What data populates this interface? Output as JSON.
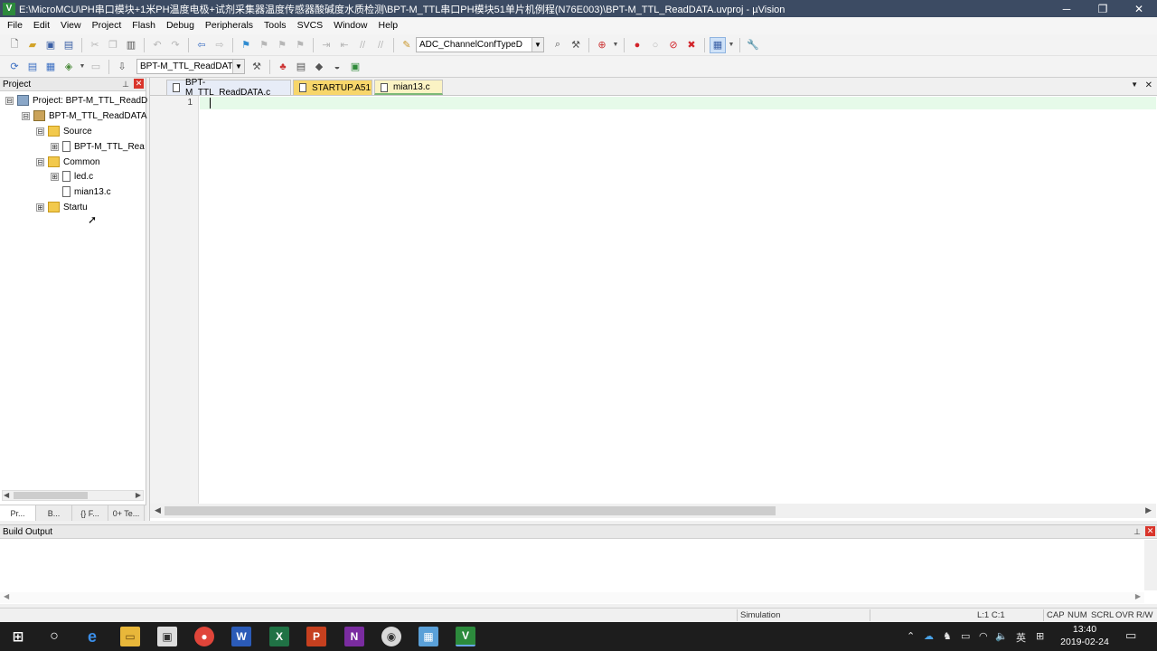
{
  "window": {
    "title": "E:\\MicroMCU\\PH串口模块+1米PH温度电极+试剂采集器温度传感器酸碱度水质检测\\BPT-M_TTL串口PH模块51单片机例程(N76E003)\\BPT-M_TTL_ReadDATA.uvproj - µVision",
    "minimize": "─",
    "maximize": "❐",
    "close": "✕"
  },
  "menu": [
    "File",
    "Edit",
    "View",
    "Project",
    "Flash",
    "Debug",
    "Peripherals",
    "Tools",
    "SVCS",
    "Window",
    "Help"
  ],
  "toolbar": {
    "function_combo": "ADC_ChannelConfTypeD",
    "target_combo": "BPT-M_TTL_ReadDATA"
  },
  "project_panel": {
    "title": "Project",
    "tree": [
      {
        "label": "Project: BPT-M_TTL_ReadD",
        "kind": "project",
        "expander": "⊟"
      },
      {
        "label": "BPT-M_TTL_ReadDATA",
        "kind": "target",
        "expander": "⊟"
      },
      {
        "label": "Source",
        "kind": "folder",
        "expander": "⊟"
      },
      {
        "label": "BPT-M_TTL_Rea",
        "kind": "file",
        "expander": "⊞"
      },
      {
        "label": "Common",
        "kind": "folder",
        "expander": "⊟"
      },
      {
        "label": "led.c",
        "kind": "file",
        "expander": "⊞"
      },
      {
        "label": "mian13.c",
        "kind": "file",
        "expander": ""
      },
      {
        "label": "Startu",
        "kind": "folder",
        "expander": "⊞"
      }
    ],
    "tabs": [
      "Pr...",
      "B...",
      "{} F...",
      "0+ Te..."
    ]
  },
  "editor": {
    "tabs": [
      {
        "label": "BPT-M_TTL_ReadDATA.c"
      },
      {
        "label": "STARTUP.A51"
      },
      {
        "label": "mian13.c"
      }
    ],
    "line_number": "1"
  },
  "build_output": {
    "title": "Build Output"
  },
  "status": {
    "mode": "Simulation",
    "position": "L:1 C:1",
    "flags": [
      "CAP",
      "NUM",
      "SCRL",
      "OVR",
      "R/W"
    ]
  },
  "taskbar": {
    "time": "13:40",
    "date": "2019-02-24",
    "ime": "英"
  }
}
